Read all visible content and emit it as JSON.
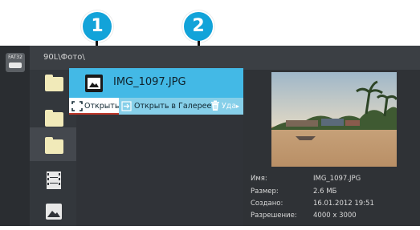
{
  "callouts": {
    "one": "1",
    "two": "2"
  },
  "storage": {
    "label": "FAT32",
    "icon": "drive-icon"
  },
  "path": "90L\\Фото\\",
  "file": {
    "name": "IMG_1097.JPG",
    "icon": "image-file-icon"
  },
  "actions": [
    {
      "label": "Открыть",
      "icon": "open-icon"
    },
    {
      "label": "Открыть в Галерее",
      "icon": "gallery-open-icon"
    },
    {
      "label": "Уда",
      "icon": "trash-icon"
    }
  ],
  "details": [
    {
      "key": "Имя:",
      "value": "IMG_1097.JPG"
    },
    {
      "key": "Размер:",
      "value": "2.6 МБ"
    },
    {
      "key": "Создано:",
      "value": "16.01.2012 19:51"
    },
    {
      "key": "Разрешение:",
      "value": "4000 x 3000"
    }
  ],
  "colors": {
    "accent": "#43b9e6",
    "callout": "#12a3d9",
    "background": "#303338"
  }
}
